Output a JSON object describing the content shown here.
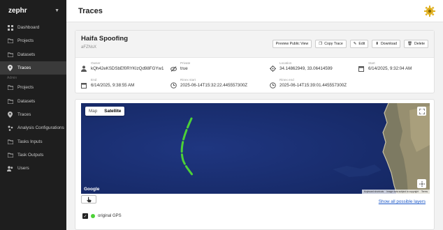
{
  "app": {
    "name": "zephr"
  },
  "sidebar": {
    "items": [
      {
        "label": "Dashboard",
        "icon": "grid-icon"
      },
      {
        "label": "Projects",
        "icon": "folder-icon"
      },
      {
        "label": "Datasets",
        "icon": "folder-icon"
      },
      {
        "label": "Traces",
        "icon": "location-pin-icon",
        "active": true
      }
    ],
    "admin_label": "Admin",
    "admin_items": [
      {
        "label": "Projects",
        "icon": "folder-icon"
      },
      {
        "label": "Datasets",
        "icon": "folder-icon"
      },
      {
        "label": "Traces",
        "icon": "location-pin-icon"
      },
      {
        "label": "Analysis Configurations",
        "icon": "sliders-icon"
      },
      {
        "label": "Tasks Inputs",
        "icon": "folder-icon"
      },
      {
        "label": "Task Outputs",
        "icon": "folder-icon"
      },
      {
        "label": "Users",
        "icon": "users-icon"
      }
    ]
  },
  "header": {
    "title": "Traces"
  },
  "trace": {
    "name": "Haifa Spoofing",
    "id": "aFZNsX",
    "actions": {
      "preview": "Preview Public View",
      "copy": "Copy Trace",
      "edit": "Edit",
      "download": "Download",
      "delete": "Delete"
    },
    "meta": [
      {
        "label": "Owner",
        "value": "kQh42eKSDSbEf0RYKIzQd98FGYw1",
        "icon": "user-icon"
      },
      {
        "label": "Private",
        "value": "true",
        "icon": "eye-off-icon"
      },
      {
        "label": "Location",
        "value": "34.14862949, 33.06414599",
        "icon": "crosshair-icon"
      },
      {
        "label": "Start",
        "value": "6/14/2025, 9:32:04 AM",
        "icon": "calendar-icon"
      },
      {
        "label": "End",
        "value": "6/14/2025, 9:38:55 AM",
        "icon": "calendar-icon"
      },
      {
        "label": "Rinex start",
        "value": "2025-06-14T15:32:22.445557300Z",
        "icon": "clock-icon"
      },
      {
        "label": "Rinex end",
        "value": "2025-06-14T15:39:01.445557300Z",
        "icon": "clock-icon"
      }
    ]
  },
  "map": {
    "type_map": "Map",
    "type_satellite": "Satellite",
    "selected": "Satellite",
    "google": "Google",
    "attribution": [
      "Keyboard shortcuts",
      "Image data subject to copyright",
      "Terms"
    ]
  },
  "layers": {
    "show_all": "Show all possible layers"
  },
  "legend": [
    {
      "label": "original GPS",
      "color": "#4cd137",
      "checked": true
    }
  ]
}
